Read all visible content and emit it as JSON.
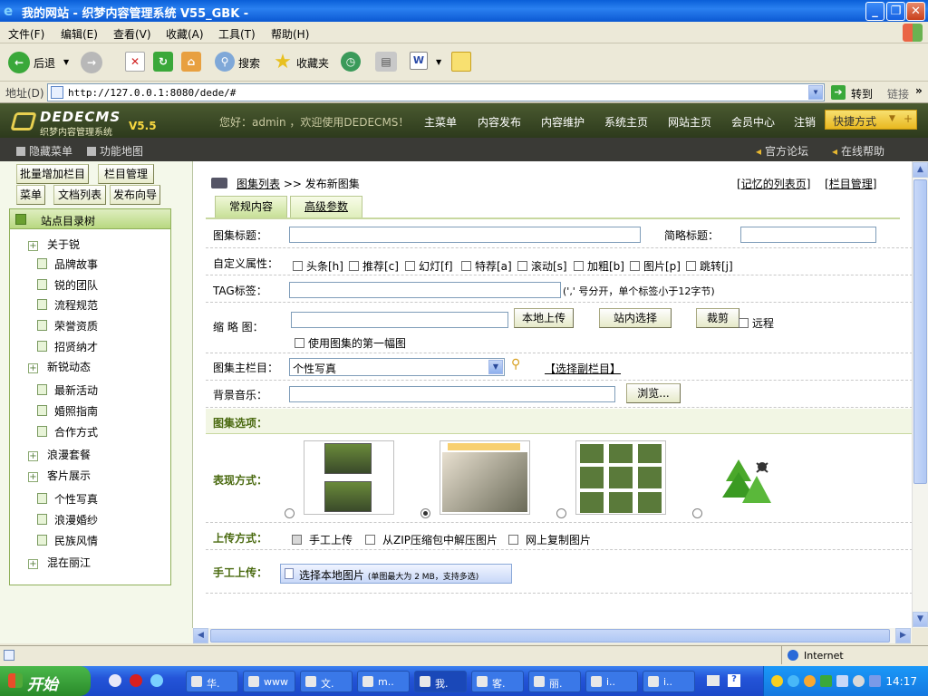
{
  "window": {
    "title": "我的网站 - 织梦内容管理系统 V55_GBK -",
    "min": "_",
    "max": "❐",
    "close": "✕"
  },
  "menu": [
    "文件(F)",
    "编辑(E)",
    "查看(V)",
    "收藏(A)",
    "工具(T)",
    "帮助(H)"
  ],
  "toolbar": {
    "back": "后退",
    "search": "搜索",
    "favorites": "收藏夹"
  },
  "address": {
    "label": "地址(D)",
    "url": "http://127.0.0.1:8080/dede/#",
    "go": "转到",
    "links": "链接"
  },
  "cms": {
    "logo_main": "DEDECMS",
    "logo_sub": "织梦内容管理系统",
    "version": "V5.5",
    "greeting": "您好：admin ，欢迎使用DEDECMS！",
    "nav": [
      "主菜单",
      "内容发布",
      "内容维护",
      "系统主页",
      "网站主页",
      "会员中心",
      "注销"
    ],
    "quick": "快捷方式",
    "hide_menu": "隐藏菜单",
    "func_map": "功能地图",
    "forum": "官方论坛",
    "help": "在线帮助"
  },
  "left": {
    "btn_batch": "批量增加栏目",
    "btn_manage": "栏目管理",
    "btn_menu": "菜单",
    "btn_doclist": "文档列表",
    "btn_guide": "发布向导",
    "tree_title": "站点目录树",
    "tree": [
      {
        "label": "关于锐",
        "type": "folder"
      },
      {
        "label": "品牌故事",
        "type": "doc"
      },
      {
        "label": "锐的团队",
        "type": "doc"
      },
      {
        "label": "流程规范",
        "type": "doc"
      },
      {
        "label": "荣誉资质",
        "type": "doc"
      },
      {
        "label": "招贤纳才",
        "type": "doc"
      },
      {
        "label": "新锐动态",
        "type": "folder"
      },
      {
        "label": "最新活动",
        "type": "doc"
      },
      {
        "label": "婚照指南",
        "type": "doc"
      },
      {
        "label": "合作方式",
        "type": "doc"
      },
      {
        "label": "浪漫套餐",
        "type": "folder"
      },
      {
        "label": "客片展示",
        "type": "folder"
      },
      {
        "label": "个性写真",
        "type": "doc"
      },
      {
        "label": "浪漫婚纱",
        "type": "doc"
      },
      {
        "label": "民族风情",
        "type": "doc"
      },
      {
        "label": "混在丽江",
        "type": "folder"
      }
    ]
  },
  "form": {
    "crumb_link": "图集列表",
    "crumb_sep": ">>",
    "crumb_current": "发布新图集",
    "link_list": "记忆的列表页",
    "link_col": "栏目管理",
    "tab_normal": "常规内容",
    "tab_advanced": "高级参数",
    "title_label": "图集标题：",
    "short_title_label": "简略标题：",
    "attr_label": "自定义属性：",
    "attrs": [
      "头条[h]",
      "推荐[c]",
      "幻灯[f]",
      "特荐[a]",
      "滚动[s]",
      "加粗[b]",
      "图片[p]",
      "跳转[j]"
    ],
    "tag_label": "TAG标签：",
    "tag_hint": "(',' 号分开，单个标签小于12字节)",
    "thumb_label": "缩 略 图：",
    "btn_upload": "本地上传",
    "btn_site": "站内选择",
    "btn_crop": "裁剪",
    "remote": "远程",
    "use_first": "使用图集的第一幅图",
    "col_label": "图集主栏目：",
    "col_value": "个性写真",
    "sub_col": "【选择副栏目】",
    "music_label": "背景音乐：",
    "btn_browse": "浏览...",
    "options_title": "图集选项：",
    "style_label": "表现方式：",
    "upload_label": "上传方式：",
    "upload_opts": [
      "手工上传",
      "从ZIP压缩包中解压图片",
      "网上复制图片"
    ],
    "manual_label": "手工上传：",
    "choose_img": "选择本地图片",
    "choose_hint": "(单图最大为 2 MB，支持多选)"
  },
  "status": {
    "zone": "Internet"
  },
  "taskbar": {
    "start": "开始",
    "tasks": [
      "华.",
      "www",
      "文.",
      "m..",
      "我.",
      "客.",
      "丽.",
      "i..",
      "i.."
    ],
    "time": "14:17"
  }
}
